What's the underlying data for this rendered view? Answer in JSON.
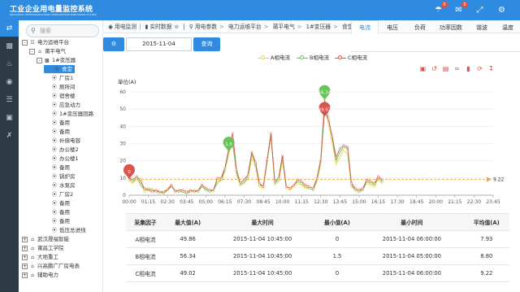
{
  "app": {
    "title": "工业企业用电量监控系统",
    "subtitle": "INDUSTRIAL ENTERPRISE POWER CONSUMPTION MONITORING SYSTEM"
  },
  "topbar": {
    "bell_badge": "0",
    "mail_badge": "0"
  },
  "search": {
    "placeholder": "搜索"
  },
  "tree": [
    {
      "label": "电力运维平台",
      "level": 0,
      "exp": "-",
      "icon": "org"
    },
    {
      "label": "莆平电气",
      "level": 1,
      "exp": "-",
      "icon": "house"
    },
    {
      "label": "1#变压器",
      "level": 2,
      "exp": "-",
      "icon": "folder"
    },
    {
      "label": "食堂",
      "level": 3,
      "exp": "",
      "icon": "meter",
      "selected": true
    },
    {
      "label": "厂房1",
      "level": 3,
      "exp": "",
      "icon": "meter"
    },
    {
      "label": "厕所间",
      "level": 3,
      "exp": "",
      "icon": "meter"
    },
    {
      "label": "宿舍楼",
      "level": 3,
      "exp": "",
      "icon": "meter"
    },
    {
      "label": "应急动力",
      "level": 3,
      "exp": "",
      "icon": "meter"
    },
    {
      "label": "1#变压器回路",
      "level": 3,
      "exp": "",
      "icon": "meter"
    },
    {
      "label": "备用",
      "level": 3,
      "exp": "",
      "icon": "meter"
    },
    {
      "label": "备用",
      "level": 3,
      "exp": "",
      "icon": "meter"
    },
    {
      "label": "补偿电容",
      "level": 3,
      "exp": "",
      "icon": "meter"
    },
    {
      "label": "办公楼2",
      "level": 3,
      "exp": "",
      "icon": "meter"
    },
    {
      "label": "办公楼1",
      "level": 3,
      "exp": "",
      "icon": "meter"
    },
    {
      "label": "备用",
      "level": 3,
      "exp": "",
      "icon": "meter"
    },
    {
      "label": "锅炉房",
      "level": 3,
      "exp": "",
      "icon": "meter"
    },
    {
      "label": "水泵房",
      "level": 3,
      "exp": "",
      "icon": "meter"
    },
    {
      "label": "厂房2",
      "level": 3,
      "exp": "",
      "icon": "meter"
    },
    {
      "label": "备用",
      "level": 3,
      "exp": "",
      "icon": "meter"
    },
    {
      "label": "备用",
      "level": 3,
      "exp": "",
      "icon": "meter"
    },
    {
      "label": "备用",
      "level": 3,
      "exp": "",
      "icon": "meter"
    },
    {
      "label": "低压总进线",
      "level": 3,
      "exp": "",
      "icon": "meter"
    },
    {
      "label": "武汉晟福智能",
      "level": 0,
      "exp": "+",
      "icon": "house"
    },
    {
      "label": "莆昌工学院",
      "level": 0,
      "exp": "+",
      "icon": "house"
    },
    {
      "label": "大地重工",
      "level": 0,
      "exp": "+",
      "icon": "house"
    },
    {
      "label": "兴高鹏广厂房电表",
      "level": 0,
      "exp": "+",
      "icon": "house"
    },
    {
      "label": "辅助电力",
      "level": 0,
      "exp": "+",
      "icon": "house"
    }
  ],
  "breadcrumb": [
    "用电监测",
    "实时数据",
    "用电参数",
    "电力运维平台",
    "莆平电气",
    "1#变压器",
    "食堂"
  ],
  "datebar": {
    "date": "2015-11-04",
    "query_label": "查询"
  },
  "tabs": [
    "电流",
    "电压",
    "负荷",
    "功率因数",
    "谐波",
    "温度"
  ],
  "active_tab": 0,
  "chart_data": {
    "type": "line",
    "ylabel": "单位(A)",
    "ylim": [
      0,
      60
    ],
    "yticks": [
      0,
      10,
      20,
      30,
      40,
      50,
      60
    ],
    "xtick_labels": [
      "00:00",
      "01:15",
      "02:30",
      "03:45",
      "05:00",
      "06:15",
      "07:30",
      "08:45",
      "10:00",
      "11:15",
      "12:30",
      "13:45",
      "15:00",
      "16:15",
      "17:30",
      "18:45",
      "20:00",
      "21:15",
      "22:30",
      "23:45"
    ],
    "interval_minutes": 15,
    "series": [
      {
        "name": "A相电流",
        "color": "#e8d44d",
        "values": [
          8,
          7,
          9,
          10,
          2,
          3,
          4,
          2,
          1,
          2,
          4,
          6,
          2,
          3,
          2,
          1,
          3,
          2,
          2,
          6,
          4,
          3,
          2,
          9,
          8,
          14,
          24,
          33,
          12,
          6,
          8,
          9,
          22,
          16,
          5,
          4,
          19,
          35,
          6,
          8,
          20,
          4,
          3,
          5,
          7,
          6,
          4,
          4,
          3,
          8,
          18,
          50,
          42,
          30,
          18,
          22,
          26,
          24,
          5,
          3,
          2,
          4,
          7,
          6,
          5,
          9,
          7
        ]
      },
      {
        "name": "B相电流",
        "color": "#6ac259",
        "values": [
          9,
          8,
          10,
          6,
          3,
          4,
          3,
          2,
          2,
          1,
          3,
          5,
          3,
          2,
          2,
          1,
          2,
          3,
          2,
          5,
          3,
          2,
          3,
          7,
          9,
          15,
          26,
          30,
          14,
          6,
          7,
          11,
          24,
          18,
          6,
          5,
          20,
          34,
          7,
          9,
          22,
          5,
          4,
          6,
          8,
          7,
          5,
          4,
          3,
          9,
          20,
          56,
          45,
          33,
          20,
          25,
          28,
          27,
          6,
          3,
          2,
          3,
          8,
          7,
          6,
          10,
          8
        ]
      },
      {
        "name": "C相电流",
        "color": "#d9534f",
        "values": [
          10,
          9,
          11,
          8,
          4,
          3,
          2,
          3,
          2,
          2,
          3,
          6,
          2,
          3,
          3,
          2,
          3,
          2,
          3,
          6,
          4,
          3,
          3,
          10,
          10,
          16,
          27,
          36,
          15,
          7,
          9,
          12,
          25,
          19,
          7,
          5,
          21,
          36,
          8,
          10,
          23,
          5,
          4,
          6,
          9,
          8,
          6,
          5,
          4,
          10,
          21,
          49,
          44,
          34,
          22,
          27,
          29,
          28,
          7,
          4,
          3,
          4,
          9,
          8,
          7,
          11,
          9
        ]
      }
    ],
    "markers": [
      {
        "series": "B相电流",
        "label": "56.34",
        "kind": "max"
      },
      {
        "series": "C相电流",
        "label": "49.02",
        "kind": "max"
      },
      {
        "series": "B相电流",
        "label": "1.5",
        "kind": "min"
      },
      {
        "series": "C相电流",
        "label": "0",
        "kind": "min"
      }
    ],
    "avg_line": {
      "value": 9.22,
      "label": "9.22",
      "color": "#e8a93c"
    }
  },
  "table": {
    "headers": [
      "采集因子",
      "最大值(A)",
      "最大时间",
      "最小值(A)",
      "最小时间",
      "平均值(A)"
    ],
    "rows": [
      [
        "A相电流",
        "49.86",
        "2015-11-04 10:45:00",
        "0",
        "2015-11-04 06:00:00",
        "7.93"
      ],
      [
        "B相电流",
        "56.34",
        "2015-11-04 10:45:00",
        "1.5",
        "2015-11-04 05:00:00",
        "8.80"
      ],
      [
        "C相电流",
        "49.02",
        "2015-11-04 10:45:00",
        "0",
        "2015-11-04 06:00:00",
        "9.22"
      ]
    ]
  }
}
